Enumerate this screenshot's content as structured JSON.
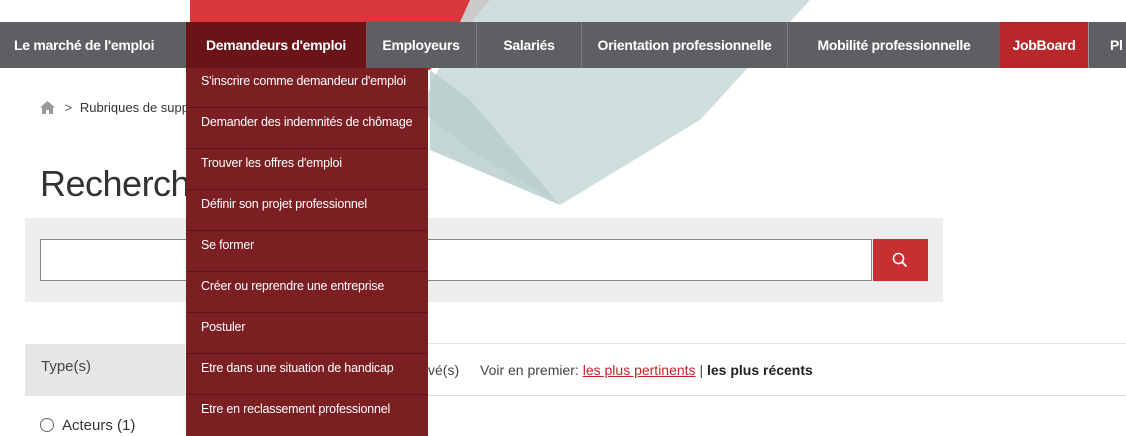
{
  "nav": {
    "items": [
      {
        "label": "Le marché de l'emploi"
      },
      {
        "label": "Demandeurs d'emploi"
      },
      {
        "label": "Employeurs"
      },
      {
        "label": "Salariés"
      },
      {
        "label": "Orientation professionnelle"
      },
      {
        "label": "Mobilité professionnelle"
      },
      {
        "label": "JobBoard"
      },
      {
        "label": "Pl"
      }
    ],
    "colors": {
      "bar": "#5f5f63",
      "active": "#6b1418",
      "jobboard": "#b8282a"
    }
  },
  "dropdown": {
    "items": [
      {
        "label": "S'inscrire comme demandeur d'emploi"
      },
      {
        "label": "Demander des indemnités de chômage"
      },
      {
        "label": "Trouver les offres d'emploi"
      },
      {
        "label": "Définir son projet professionnel"
      },
      {
        "label": "Se former"
      },
      {
        "label": "Créer ou reprendre une entreprise"
      },
      {
        "label": "Postuler"
      },
      {
        "label": "Etre dans une situation de handicap"
      },
      {
        "label": "Etre en reclassement professionnel"
      }
    ],
    "color": "#7b1f22"
  },
  "breadcrumb": {
    "home_icon": "home-icon",
    "separator": ">",
    "item": "Rubriques de support"
  },
  "page": {
    "title": "Recherche"
  },
  "search": {
    "placeholder": "",
    "value": "",
    "button_icon": "search-icon",
    "button_color": "#c72f33"
  },
  "filters": {
    "type_label": "Type(s)",
    "options": [
      {
        "label": "Acteurs (1)",
        "checked": false
      }
    ]
  },
  "results": {
    "count_suffix": "vé(s)",
    "sort_prefix": "Voir en premier:",
    "sort_relevant": "les plus pertinents",
    "sort_separator": "|",
    "sort_recent": "les plus récents"
  }
}
